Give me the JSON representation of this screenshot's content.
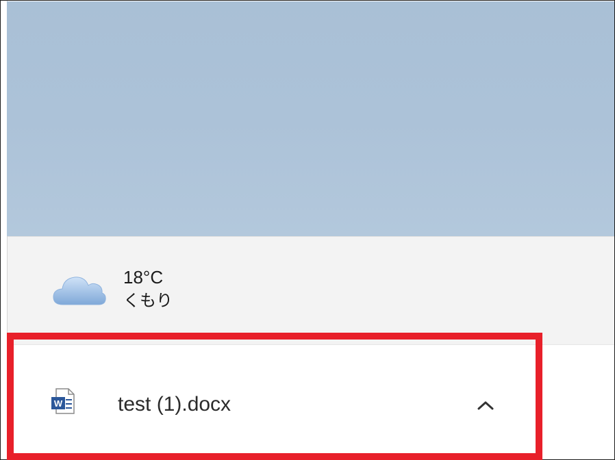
{
  "weather": {
    "icon": "cloud-icon",
    "temperature": "18°C",
    "condition": "くもり"
  },
  "download": {
    "file_icon": "word-document-icon",
    "file_name": "test (1).docx",
    "expand_icon": "chevron-up-icon"
  },
  "colors": {
    "highlight": "#e8202a",
    "desktop": "#acc2d8",
    "taskbar": "#f3f3f3"
  }
}
